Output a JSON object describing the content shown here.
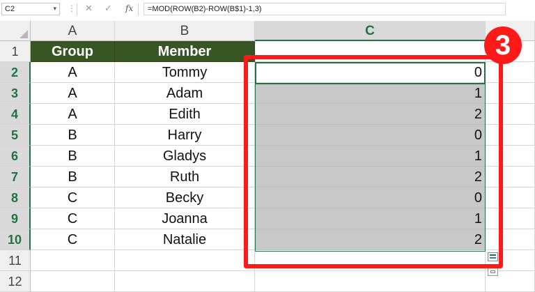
{
  "formula_bar": {
    "name_box": "C2",
    "formula": "=MOD(ROW(B2)-ROW(B$1)-1,3)",
    "fx_label": "fx",
    "cancel_glyph": "✕",
    "enter_glyph": "✓",
    "dots_glyph": "⋮"
  },
  "columns": [
    "A",
    "B",
    "C"
  ],
  "rows": [
    "1",
    "2",
    "3",
    "4",
    "5",
    "6",
    "7",
    "8",
    "9",
    "10",
    "11",
    "12"
  ],
  "table": {
    "headers": [
      "Group",
      "Member"
    ],
    "data": [
      {
        "group": "A",
        "member": "Tommy",
        "c": "0"
      },
      {
        "group": "A",
        "member": "Adam",
        "c": "1"
      },
      {
        "group": "A",
        "member": "Edith",
        "c": "2"
      },
      {
        "group": "B",
        "member": "Harry",
        "c": "0"
      },
      {
        "group": "B",
        "member": "Gladys",
        "c": "1"
      },
      {
        "group": "B",
        "member": "Ruth",
        "c": "2"
      },
      {
        "group": "C",
        "member": "Becky",
        "c": "0"
      },
      {
        "group": "C",
        "member": "Joanna",
        "c": "1"
      },
      {
        "group": "C",
        "member": "Natalie",
        "c": "2"
      }
    ]
  },
  "step_badge": "3",
  "colors": {
    "header_fill": "#375623",
    "selection_accent": "#217346",
    "highlight_red": "#ff1a1a",
    "range_shade": "#c7c7c7"
  }
}
